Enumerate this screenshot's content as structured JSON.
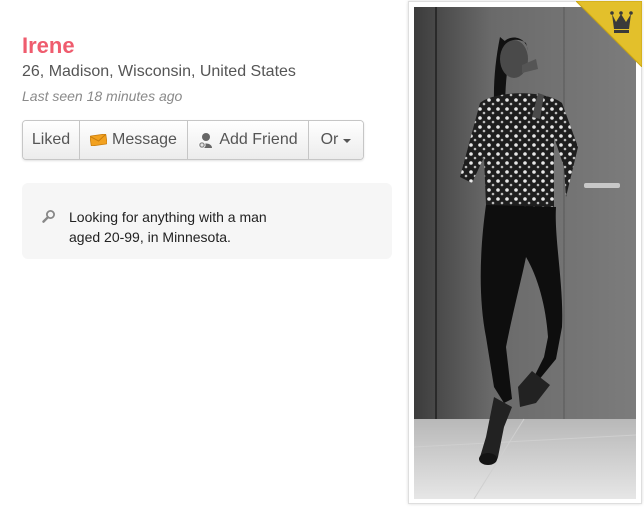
{
  "profile": {
    "name": "Irene",
    "location": "26, Madison, Wisconsin, United States",
    "last_seen": "Last seen 18 minutes ago"
  },
  "actions": {
    "liked": "Liked",
    "message": "Message",
    "add_friend": "Add Friend",
    "more": "Or"
  },
  "looking_for": {
    "text": "Looking for anything with a man aged 20-99, in Minnesota."
  },
  "icons": {
    "message": "envelope-icon",
    "add_friend": "add-friend-icon",
    "search": "search-icon",
    "badge": "crown-icon"
  },
  "colors": {
    "name": "#ef5c6e",
    "badge": "#e3c02b"
  }
}
